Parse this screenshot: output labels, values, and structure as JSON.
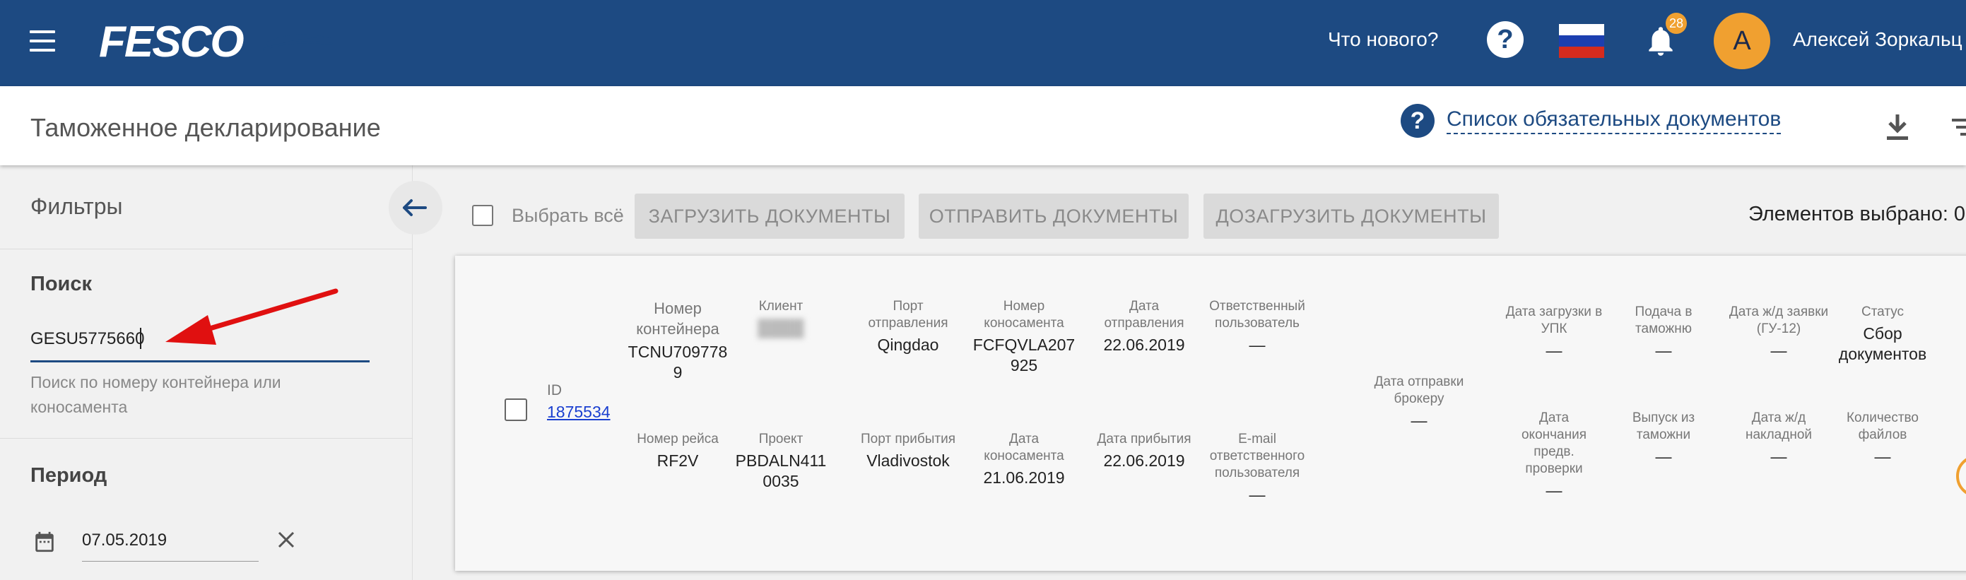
{
  "colors": {
    "brand": "#1d4a82",
    "accent": "#f0a030",
    "link": "#1a3fd0",
    "annotation": "#e01010"
  },
  "topbar": {
    "logo": "FESCO",
    "whats_new": "Что нового?",
    "notifications_count": "28",
    "avatar_letter": "А",
    "user_name": "Алексей Зоркальц",
    "icons": {
      "menu": "menu-icon",
      "help": "help-icon",
      "flag": "russia-flag-icon",
      "bell": "bell-icon"
    }
  },
  "subheader": {
    "title": "Таможенное декларирование",
    "docs_link": "Список обязательных документов",
    "icons": {
      "help": "help-icon",
      "download": "download-icon",
      "filter": "filter-icon"
    }
  },
  "sidebar": {
    "title": "Фильтры",
    "search": {
      "label": "Поиск",
      "value": "GESU5775660",
      "hint": "Поиск по номеру контейнера или коносамента"
    },
    "period": {
      "label": "Период",
      "date_from": "07.05.2019"
    }
  },
  "toolbar": {
    "select_all": "Выбрать всё",
    "buttons": [
      "ЗАГРУЗИТЬ ДОКУМЕНТЫ",
      "ОТПРАВИТЬ ДОКУМЕНТЫ",
      "ДОЗАГРУЗИТЬ ДОКУМЕНТЫ"
    ],
    "selected_count": "Элементов выбрано: 0"
  },
  "record": {
    "id_label": "ID",
    "id": "1875534",
    "container": {
      "label": "Номер контейнера",
      "value": "TCNU7097789"
    },
    "client": {
      "label": "Клиент",
      "value": "████"
    },
    "port_departure": {
      "label": "Порт отправления",
      "value": "Qingdao"
    },
    "bill_number": {
      "label": "Номер коносамента",
      "value": "FCFQVLA207925"
    },
    "departure_date": {
      "label": "Дата отправления",
      "value": "22.06.2019"
    },
    "responsible_user": {
      "label": "Ответственный пользователь",
      "value": "—"
    },
    "broker_send_date": {
      "label": "Дата отправки брокеру",
      "value": "—"
    },
    "upk_upload_date": {
      "label": "Дата загрузки в УПК",
      "value": "—"
    },
    "customs_submission": {
      "label": "Подача в таможню",
      "value": "—"
    },
    "rail_request_date": {
      "label": "Дата ж/д заявки (ГУ-12)",
      "value": "—"
    },
    "status": {
      "label": "Статус",
      "value": "Сбор документов"
    },
    "voyage": {
      "label": "Номер рейса",
      "value": "RF2V"
    },
    "project": {
      "label": "Проект",
      "value": "PBDALN4110035"
    },
    "port_arrival": {
      "label": "Порт прибытия",
      "value": "Vladivostok"
    },
    "bill_date": {
      "label": "Дата коносамента",
      "value": "21.06.2019"
    },
    "arrival_date": {
      "label": "Дата прибытия",
      "value": "22.06.2019"
    },
    "responsible_email": {
      "label": "E-mail ответственного пользователя",
      "value": "—"
    },
    "precheck_end": {
      "label": "Дата окончания предв. проверки",
      "value": "—"
    },
    "customs_release": {
      "label": "Выпуск из таможни",
      "value": "—"
    },
    "rail_invoice_date": {
      "label": "Дата ж/д накладной",
      "value": "—"
    },
    "files_count": {
      "label": "Количество файлов",
      "value": "—"
    }
  }
}
